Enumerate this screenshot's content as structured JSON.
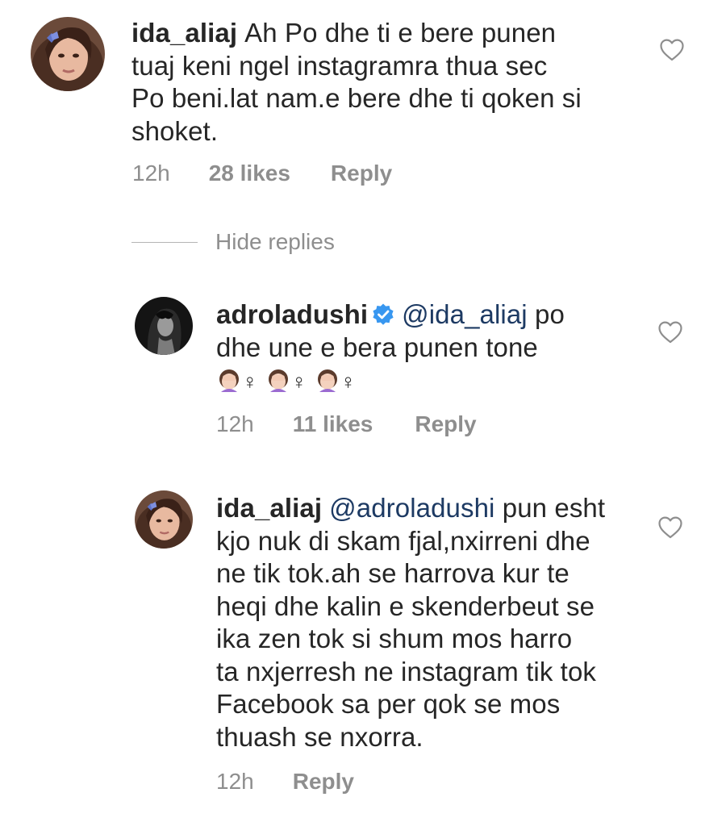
{
  "comments": [
    {
      "username": "ida_aliaj",
      "lines": [
        "Ah Po dhe ti e bere punen",
        "tuaj keni ngel instagramra thua sec",
        "Po beni.lat nam.e bere dhe ti qoken si",
        "shoket."
      ],
      "time": "12h",
      "likes": "28 likes",
      "reply": "Reply"
    },
    {
      "username": "adroladushi",
      "verified": true,
      "mention": "@ida_aliaj",
      "first_line_rest": " po",
      "lines": [
        "dhe une e bera punen tone"
      ],
      "emoji_line": "🤦🏻‍♀️🤦🏻‍♀️🤦🏻‍♀️",
      "emoji_glyph": "♀",
      "time": "12h",
      "likes": "11 likes",
      "reply": "Reply"
    },
    {
      "username": "ida_aliaj",
      "mention": "@adroladushi",
      "first_line_rest": " pun esht",
      "lines": [
        "kjo nuk di skam fjal,nxirreni dhe",
        "ne tik tok.ah se harrova kur te",
        "heqi dhe kalin e skenderbeut se",
        "ika zen tok si shum mos harro",
        "ta nxjerresh ne instagram tik tok",
        "Facebook sa per qok se mos",
        "thuash se nxorra."
      ],
      "time": "12h",
      "reply": "Reply"
    }
  ],
  "hide_replies": "Hide replies",
  "icons": {
    "like": "heart-outline-icon",
    "verified": "verified-badge-icon",
    "facepalm": "woman-facepalming-emoji"
  },
  "colors": {
    "text": "#262626",
    "meta": "#8e8e8e",
    "mention": "#1d3a63",
    "verified": "#3897f0"
  }
}
